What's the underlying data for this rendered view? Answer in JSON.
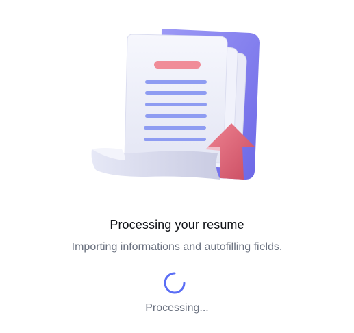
{
  "modal": {
    "illustration_icon": "document-upload-illustration",
    "title": "Processing your resume",
    "subtitle": "Importing informations and autofilling fields.",
    "status": "Processing...",
    "spinner_icon": "loading-spinner-icon"
  },
  "colors": {
    "accent": "#5b6ef5",
    "folder": "#8f8cf0",
    "arrow": "#e2677a",
    "title_text": "#111318",
    "muted_text": "#6b7280"
  }
}
